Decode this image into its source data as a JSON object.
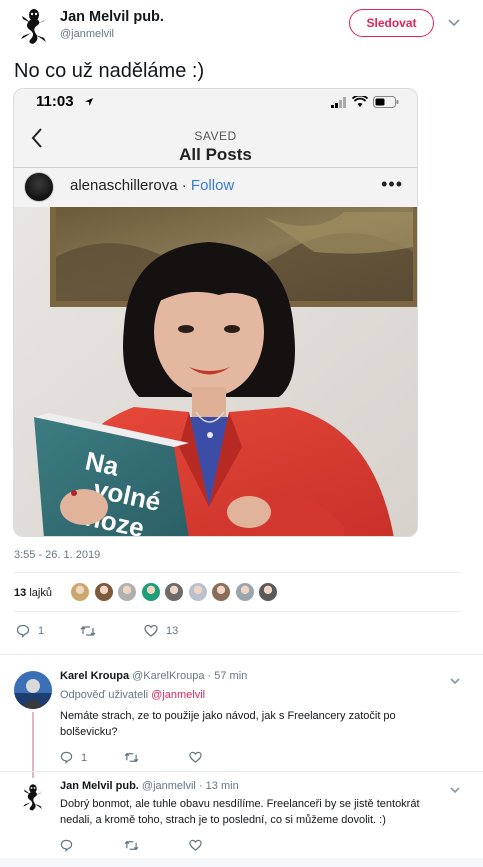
{
  "author": {
    "name": "Jan Melvil pub.",
    "handle": "@janmelvil",
    "follow_label": "Sledovat"
  },
  "tweet": {
    "text": "No co už naděláme :)",
    "timestamp": "3:55 - 26. 1. 2019",
    "likes_count": "13",
    "likes_label": "lajků",
    "reply_count": "1",
    "like_count": "13"
  },
  "embedded_screenshot": {
    "time": "11:03",
    "saved_label": "SAVED",
    "title": "All Posts",
    "username": "alenaschillerova",
    "separator": " · ",
    "follow": "Follow",
    "book_title_line1": "Na",
    "book_title_line2": "volné",
    "book_title_line3": "noze"
  },
  "likers": [
    "#c9a86b",
    "#7d5a3c",
    "#b0b0b0",
    "#1f9e7a",
    "#6b6b6b",
    "#b9c2cc",
    "#8a6d5a",
    "#9aa5ad",
    "#5a5a5a"
  ],
  "replies": [
    {
      "name": "Karel Kroupa",
      "handle": "@KarelKroupa",
      "time": "· 57 min",
      "reply_to_prefix": "Odpověď uživateli",
      "reply_to_user": "@janmelvil",
      "text": "Nemáte strach, ze to použije jako návod, jak s Freelancery zatočit po bolševicku?",
      "reply_count": "1"
    },
    {
      "name": "Jan Melvil pub.",
      "handle": "@janmelvil",
      "time": "· 13 min",
      "text": "Dobrý bonmot, ale tuhle obavu nesdílíme. Freelanceři by se jistě tentokrát nedali, a kromě toho, strach je to poslední, co si můžeme dovolit. :)"
    }
  ],
  "colors": {
    "accent": "#e0245e",
    "muted": "#657786",
    "text": "#14171a",
    "link": "#3a7bd5"
  }
}
